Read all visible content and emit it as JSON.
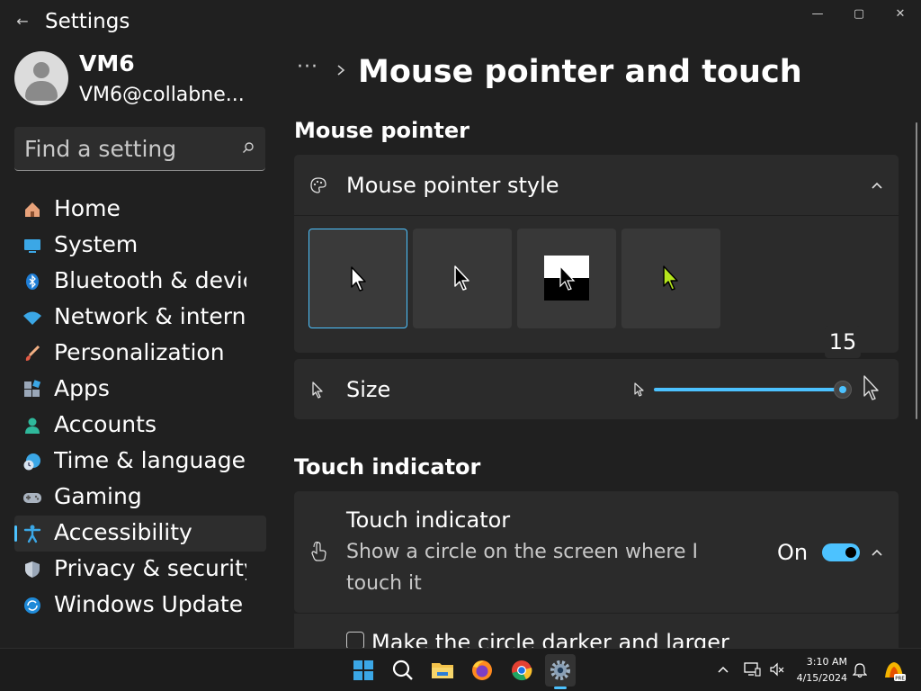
{
  "app": {
    "title": "Settings",
    "back_icon": "←"
  },
  "window_controls": {
    "minimize": "—",
    "maximize": "▢",
    "close": "✕"
  },
  "user": {
    "name": "VM6",
    "email": "VM6@collabne..."
  },
  "search": {
    "placeholder": "Find a setting"
  },
  "sidebar": {
    "items": [
      {
        "label": "Home",
        "icon": "home-icon"
      },
      {
        "label": "System",
        "icon": "system-icon"
      },
      {
        "label": "Bluetooth & devic",
        "icon": "bluetooth-icon"
      },
      {
        "label": "Network & intern",
        "icon": "network-icon"
      },
      {
        "label": "Personalization",
        "icon": "brush-icon"
      },
      {
        "label": "Apps",
        "icon": "apps-icon"
      },
      {
        "label": "Accounts",
        "icon": "accounts-icon"
      },
      {
        "label": "Time & language",
        "icon": "globe-clock-icon"
      },
      {
        "label": "Gaming",
        "icon": "gamepad-icon"
      },
      {
        "label": "Accessibility",
        "icon": "accessibility-icon",
        "active": true
      },
      {
        "label": "Privacy & security",
        "icon": "shield-icon"
      },
      {
        "label": "Windows Update",
        "icon": "update-icon"
      }
    ]
  },
  "breadcrumb": {
    "dots": "···"
  },
  "page": {
    "title": "Mouse pointer and touch"
  },
  "mouse_pointer": {
    "section_title": "Mouse pointer",
    "style": {
      "label": "Mouse pointer style",
      "options": [
        "white",
        "black",
        "inverted",
        "custom"
      ],
      "selected": "white",
      "custom_color": "#b5e61d"
    },
    "size": {
      "label": "Size",
      "value": "15",
      "level": 1.0
    }
  },
  "touch_indicator": {
    "section_title": "Touch indicator",
    "title": "Touch indicator",
    "description_line1": "Show a circle on the screen where I",
    "description_line2": "touch it",
    "state_label": "On",
    "enabled": true,
    "darker_option_label": "Make the circle darker and larger",
    "darker_checked": false
  },
  "taskbar": {
    "apps": [
      "start-icon",
      "search-icon",
      "file-explorer-icon",
      "firefox-icon",
      "chrome-icon",
      "settings-icon"
    ],
    "time": "3:10 AM",
    "date": "4/15/2024"
  },
  "colors": {
    "accent": "#4cc2ff",
    "background": "#202020",
    "card": "#2b2b2b"
  }
}
